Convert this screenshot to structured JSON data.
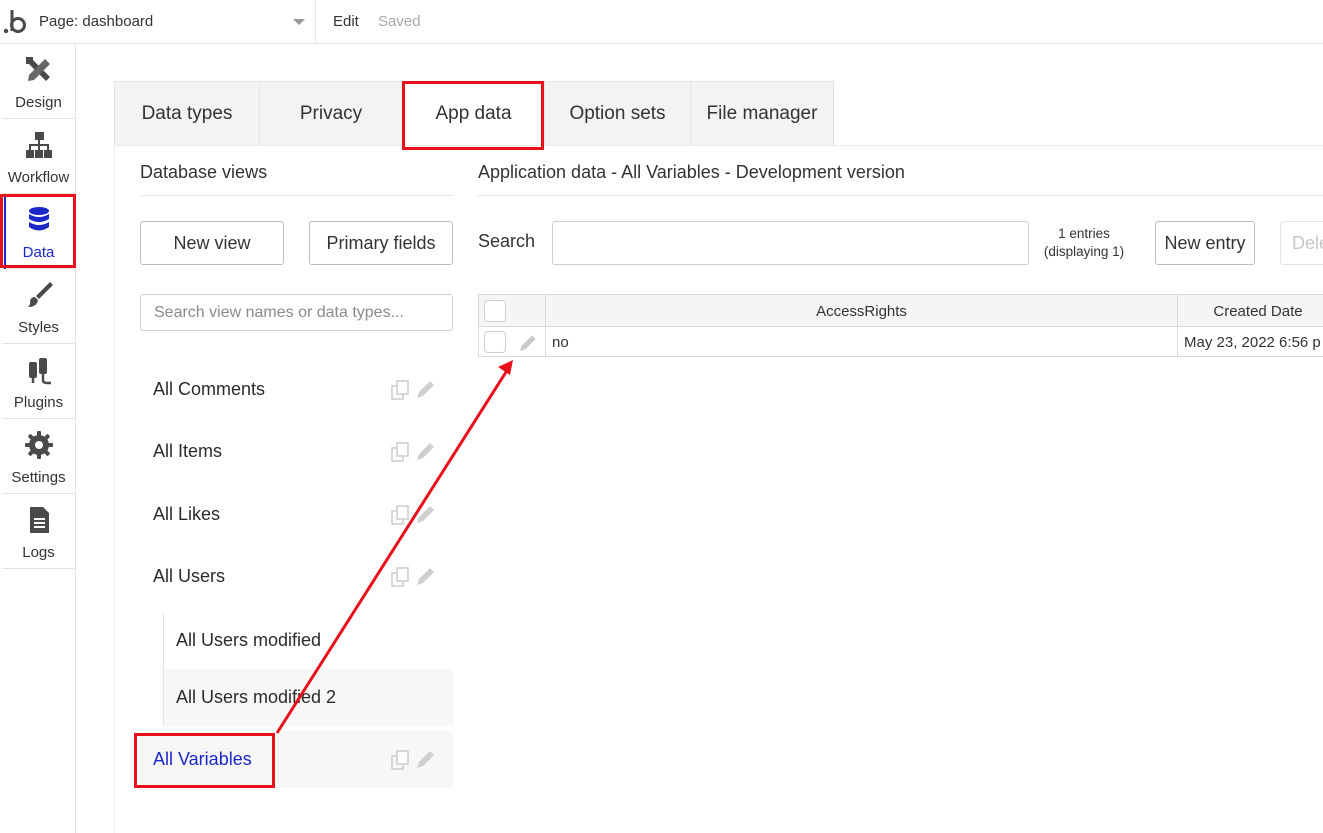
{
  "topbar": {
    "page_label": "Page: dashboard",
    "edit": "Edit",
    "saved": "Saved"
  },
  "sidebar": {
    "items": [
      {
        "label": "Design",
        "icon": "design-icon"
      },
      {
        "label": "Workflow",
        "icon": "workflow-icon"
      },
      {
        "label": "Data",
        "icon": "database-icon",
        "active": true
      },
      {
        "label": "Styles",
        "icon": "brush-icon"
      },
      {
        "label": "Plugins",
        "icon": "plug-icon"
      },
      {
        "label": "Settings",
        "icon": "gear-icon"
      },
      {
        "label": "Logs",
        "icon": "document-icon"
      }
    ]
  },
  "tabs": [
    {
      "label": "Data types"
    },
    {
      "label": "Privacy"
    },
    {
      "label": "App data",
      "active": true
    },
    {
      "label": "Option sets"
    },
    {
      "label": "File manager"
    }
  ],
  "database_views": {
    "title": "Database views",
    "new_view": "New view",
    "primary_fields": "Primary fields",
    "search_placeholder": "Search view names or data types...",
    "views": [
      "All Comments",
      "All Items",
      "All Likes",
      "All Users",
      "All Users modified",
      "All Users modified 2",
      "All Variables"
    ]
  },
  "app_data": {
    "title": "Application data - All Variables - Development version",
    "search_label": "Search",
    "entries_line1": "1 entries",
    "entries_line2": "(displaying 1)",
    "new_entry": "New entry",
    "delete": "Dele",
    "columns": [
      "AccessRights",
      "Created Date"
    ],
    "rows": [
      {
        "access_rights": "no",
        "created_date": "May 23, 2022 6:56 p"
      }
    ]
  },
  "colors": {
    "accent": "#1c27c8",
    "highlight": "#e8101a"
  }
}
